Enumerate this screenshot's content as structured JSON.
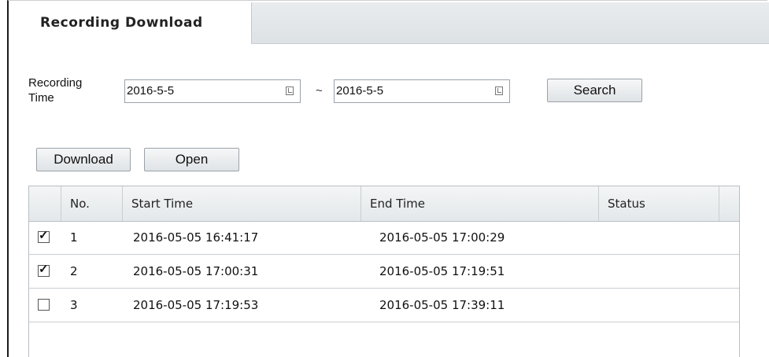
{
  "tab": {
    "label": "Recording Download"
  },
  "search": {
    "label": "Recording\nTime",
    "start_date": "2016-5-5",
    "separator": "~",
    "end_date": "2016-5-5",
    "search_label": "Search"
  },
  "toolbar": {
    "download_label": "Download",
    "open_label": "Open"
  },
  "table": {
    "headers": [
      "No.",
      "Start Time",
      "End Time",
      "Status"
    ],
    "rows": [
      {
        "checked": true,
        "no": "1",
        "start": "2016-05-05 16:41:17",
        "end": "2016-05-05 17:00:29",
        "status": ""
      },
      {
        "checked": true,
        "no": "2",
        "start": "2016-05-05 17:00:31",
        "end": "2016-05-05 17:19:51",
        "status": ""
      },
      {
        "checked": false,
        "no": "3",
        "start": "2016-05-05 17:19:53",
        "end": "2016-05-05 17:39:11",
        "status": ""
      }
    ]
  }
}
